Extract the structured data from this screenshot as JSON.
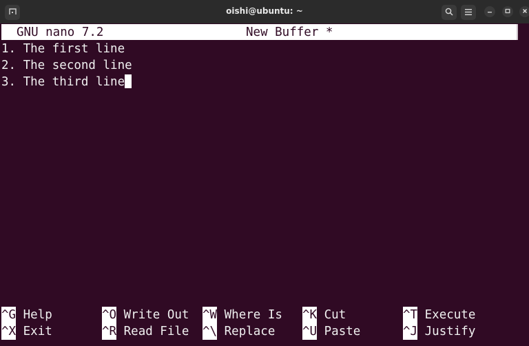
{
  "window": {
    "title": "oishi@ubuntu: ~",
    "icons": {
      "new_tab": "terminal-tab-icon",
      "search": "search-icon",
      "menu": "hamburger-menu-icon",
      "minimize": "minimize-icon",
      "maximize": "maximize-icon",
      "close": "close-icon"
    }
  },
  "nano": {
    "version": "GNU nano 7.2",
    "buffer_name": "New Buffer *",
    "lines": [
      "1. The first line",
      "2. The second line",
      "3. The third line"
    ],
    "shortcuts_row1": [
      {
        "key": "^G",
        "label": "Help"
      },
      {
        "key": "^O",
        "label": "Write Out"
      },
      {
        "key": "^W",
        "label": "Where Is"
      },
      {
        "key": "^K",
        "label": "Cut"
      },
      {
        "key": "^T",
        "label": "Execute"
      }
    ],
    "shortcuts_row2": [
      {
        "key": "^X",
        "label": "Exit"
      },
      {
        "key": "^R",
        "label": "Read File"
      },
      {
        "key": "^\\",
        "label": "Replace"
      },
      {
        "key": "^U",
        "label": "Paste"
      },
      {
        "key": "^J",
        "label": "Justify"
      }
    ]
  },
  "colors": {
    "background": "#300a24",
    "titlebar": "#2b2b2b",
    "text": "#f0f0f0",
    "highlight": "#ffffff"
  }
}
